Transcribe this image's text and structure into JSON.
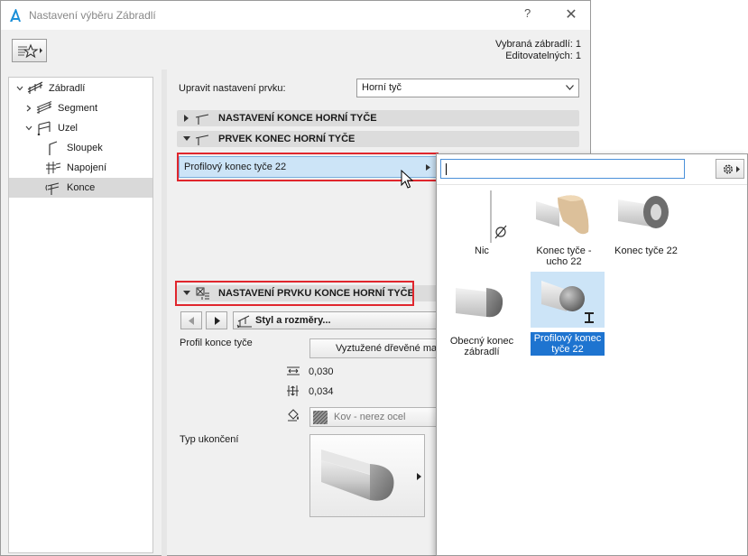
{
  "window": {
    "title": "Nastavení výběru Zábradlí",
    "help": "?",
    "close": "✕"
  },
  "stats": {
    "selected": "Vybraná zábradlí: 1",
    "editable": "Editovatelných: 1"
  },
  "tree": {
    "items": [
      {
        "label": "Zábradlí"
      },
      {
        "label": "Segment"
      },
      {
        "label": "Uzel"
      },
      {
        "label": "Sloupek"
      },
      {
        "label": "Napojení"
      },
      {
        "label": "Konce"
      }
    ]
  },
  "edit": {
    "label": "Upravit nastavení prvku:",
    "value": "Horní tyč"
  },
  "sections": {
    "end_settings": "NASTAVENÍ KONCE HORNÍ TYČE",
    "end_element": "PRVEK KONEC HORNÍ TYČE",
    "element_settings": "NASTAVENÍ PRVKU KONCE HORNÍ TYČE"
  },
  "profile_row": {
    "label": "Profilový konec tyče 22"
  },
  "style": {
    "label": "Styl a rozměry..."
  },
  "params": {
    "profile_label": "Profil konce tyče",
    "profile_value": "Vyztužené dřevěné ma",
    "dim1": "0,030",
    "dim2": "0,034",
    "material": "Kov - nerez ocel",
    "end_type_label": "Typ ukončení"
  },
  "popup": {
    "search_value": "",
    "tiles": [
      {
        "label": "Nic"
      },
      {
        "label": "Konec tyče - ucho 22"
      },
      {
        "label": "Konec tyče 22"
      },
      {
        "label": "Obecný konec zábradlí"
      },
      {
        "label": "Profilový konec tyče 22"
      }
    ]
  },
  "colors": {
    "accent": "#1e74d0",
    "selection": "#cce4f7",
    "highlight_box": "#e0262d"
  },
  "icons": {
    "app": "archicad-icon",
    "favorites": "favorites-star-icon",
    "gear": "gear-icon"
  }
}
